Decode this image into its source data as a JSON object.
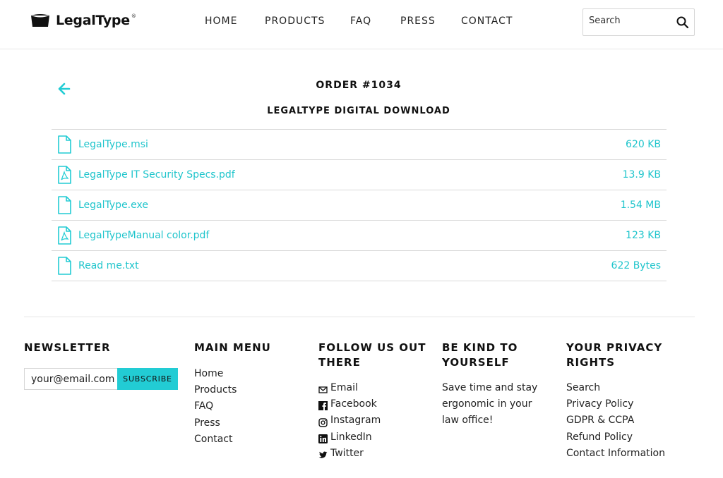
{
  "brand": {
    "name": "LegalType",
    "mark": "®"
  },
  "nav": [
    {
      "label": "HOME"
    },
    {
      "label": "PRODUCTS"
    },
    {
      "label": "FAQ"
    },
    {
      "label": "PRESS"
    },
    {
      "label": "CONTACT"
    }
  ],
  "search": {
    "placeholder": "Search",
    "icon": "search-icon"
  },
  "order": {
    "title": "ORDER #1034",
    "subtitle": "LEGALTYPE DIGITAL DOWNLOAD",
    "back_icon": "arrow-left-icon"
  },
  "files": [
    {
      "name": "LegalType.msi",
      "size": "620 KB",
      "icon": "file-icon"
    },
    {
      "name": "LegalType IT Security Specs.pdf",
      "size": "13.9 KB",
      "icon": "pdf-file-icon"
    },
    {
      "name": "LegalType.exe",
      "size": "1.54 MB",
      "icon": "file-icon"
    },
    {
      "name": "LegalTypeManual color.pdf",
      "size": "123 KB",
      "icon": "pdf-file-icon"
    },
    {
      "name": "Read me.txt",
      "size": "622 Bytes",
      "icon": "file-icon"
    }
  ],
  "footer": {
    "newsletter": {
      "heading": "NEWSLETTER",
      "email_placeholder": "your@email.com",
      "button": "SUBSCRIBE"
    },
    "main_menu": {
      "heading": "MAIN MENU",
      "items": [
        "Home",
        "Products",
        "FAQ",
        "Press",
        "Contact"
      ]
    },
    "follow": {
      "heading_line1": "FOLLOW US OUT",
      "heading_line2": "THERE",
      "items": [
        {
          "label": "Email",
          "icon": "mail-icon"
        },
        {
          "label": "Facebook",
          "icon": "facebook-icon"
        },
        {
          "label": "Instagram",
          "icon": "instagram-icon"
        },
        {
          "label": "LinkedIn",
          "icon": "linkedin-icon"
        },
        {
          "label": "Twitter",
          "icon": "twitter-icon"
        }
      ]
    },
    "kind": {
      "heading_line1": "BE KIND TO",
      "heading_line2": "YOURSELF",
      "lines": [
        "Save time and stay",
        "ergonomic in your",
        "law office!"
      ]
    },
    "privacy": {
      "heading_line1": "YOUR PRIVACY",
      "heading_line2": "RIGHTS",
      "items": [
        "Search",
        "Privacy Policy",
        "GDPR & CCPA",
        "Refund Policy",
        "Contact Information"
      ]
    }
  },
  "colors": {
    "accent": "#22ccd4",
    "link": "#20c5cc",
    "text": "#111111",
    "divider": "#d9d9d9"
  }
}
